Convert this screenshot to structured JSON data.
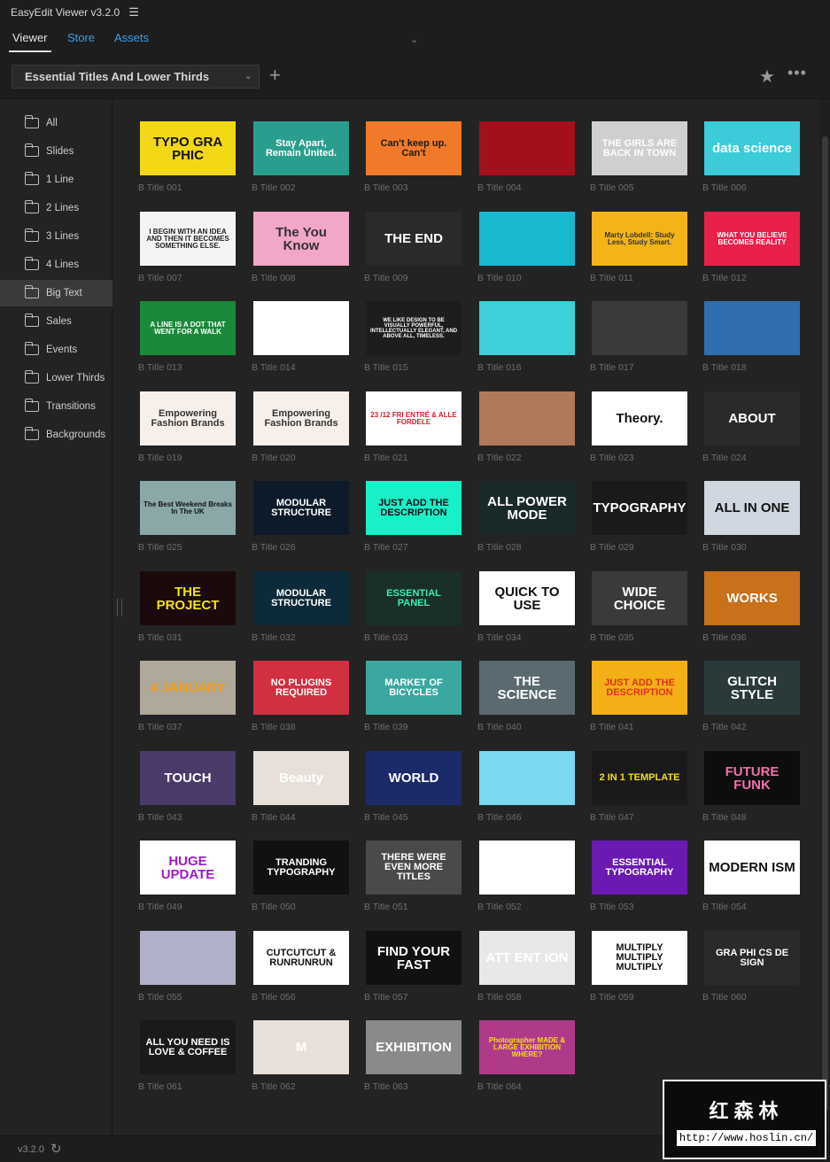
{
  "app": {
    "title": "EasyEdit Viewer v3.2.0",
    "menu_icon": "hamburger-icon"
  },
  "tabs": [
    {
      "label": "Viewer",
      "active": true
    },
    {
      "label": "Store",
      "active": false
    },
    {
      "label": "Assets",
      "active": false
    }
  ],
  "pack_select": {
    "value": "Essential Titles And Lower Thirds"
  },
  "sidebar": {
    "items": [
      {
        "label": "All"
      },
      {
        "label": "Slides"
      },
      {
        "label": "1 Line"
      },
      {
        "label": "2 Lines"
      },
      {
        "label": "3 Lines"
      },
      {
        "label": "4 Lines"
      },
      {
        "label": "Big Text",
        "active": true
      },
      {
        "label": "Sales"
      },
      {
        "label": "Events"
      },
      {
        "label": "Lower Thirds"
      },
      {
        "label": "Transitions"
      },
      {
        "label": "Backgrounds"
      }
    ]
  },
  "items": [
    {
      "caption": "B Title 001",
      "bg": "#f2d816",
      "fg": "#111111",
      "text": "TYPO GRA PHIC"
    },
    {
      "caption": "B Title 002",
      "bg": "#2a9e8e",
      "fg": "#ffffff",
      "text": "Stay Apart, Remain United."
    },
    {
      "caption": "B Title 003",
      "bg": "#f07a2a",
      "fg": "#1a1a1a",
      "text": "Can't keep up. Can't"
    },
    {
      "caption": "B Title 004",
      "bg": "#a3101c",
      "fg": "#ffffff",
      "text": ""
    },
    {
      "caption": "B Title 005",
      "bg": "#cfcfcf",
      "fg": "#ffffff",
      "text": "THE GIRLS ARE BACK IN TOWN"
    },
    {
      "caption": "B Title 006",
      "bg": "#3ccbd8",
      "fg": "#ffffff",
      "text": "data science"
    },
    {
      "caption": "B Title 007",
      "bg": "#f4f4f4",
      "fg": "#222222",
      "text": "I BEGIN WITH AN IDEA AND THEN IT BECOMES SOMETHING ELSE."
    },
    {
      "caption": "B Title 008",
      "bg": "#f2a6c8",
      "fg": "#333333",
      "text": "The You Know"
    },
    {
      "caption": "B Title 009",
      "bg": "#2a2a2a",
      "fg": "#ffffff",
      "text": "THE END"
    },
    {
      "caption": "B Title 010",
      "bg": "#1ab8d0",
      "fg": "#ffffff",
      "text": ""
    },
    {
      "caption": "B Title 011",
      "bg": "#f2b416",
      "fg": "#333333",
      "text": "Marty Lobdell: Study Less, Study Smart."
    },
    {
      "caption": "B Title 012",
      "bg": "#e8204a",
      "fg": "#ffffff",
      "text": "WHAT YOU BELIEVE BECOMES REALITY"
    },
    {
      "caption": "B Title 013",
      "bg": "#1a8a3a",
      "fg": "#ffffff",
      "text": "A LINE IS A DOT THAT WENT FOR A WALK"
    },
    {
      "caption": "B Title 014",
      "bg": "#ffffff",
      "fg": "#3a3a9a",
      "text": ""
    },
    {
      "caption": "B Title 015",
      "bg": "#1d1d1d",
      "fg": "#ffffff",
      "text": "WE LIKE DESIGN TO BE VISUALLY POWERFUL, INTELLECTUALLY ELEGANT, AND ABOVE ALL, TIMELESS."
    },
    {
      "caption": "B Title 016",
      "bg": "#3cd0d8",
      "fg": "#ffffff",
      "text": ""
    },
    {
      "caption": "B Title 017",
      "bg": "#3a3a3a",
      "fg": "#ffffff",
      "text": ""
    },
    {
      "caption": "B Title 018",
      "bg": "#2f6fb0",
      "fg": "#ffffff",
      "text": ""
    },
    {
      "caption": "B Title 019",
      "bg": "#f7f0ea",
      "fg": "#333333",
      "text": "Empowering Fashion Brands"
    },
    {
      "caption": "B Title 020",
      "bg": "#f7f0ea",
      "fg": "#333333",
      "text": "Empowering Fashion Brands"
    },
    {
      "caption": "B Title 021",
      "bg": "#ffffff",
      "fg": "#d81e2a",
      "text": "23 /12 FRI ENTRÉ & ALLE FORDELE"
    },
    {
      "caption": "B Title 022",
      "bg": "#b07a5a",
      "fg": "#ffffff",
      "text": ""
    },
    {
      "caption": "B Title 023",
      "bg": "#ffffff",
      "fg": "#111111",
      "text": "Theory."
    },
    {
      "caption": "B Title 024",
      "bg": "#2a2a2a",
      "fg": "#ffffff",
      "text": "ABOUT"
    },
    {
      "caption": "B Title 025",
      "bg": "#8aa8a8",
      "fg": "#111111",
      "text": "The Best Weekend Breaks In The UK"
    },
    {
      "caption": "B Title 026",
      "bg": "#0d1a2a",
      "fg": "#ffffff",
      "text": "MODULAR STRUCTURE"
    },
    {
      "caption": "B Title 027",
      "bg": "#18f0c8",
      "fg": "#111111",
      "text": "JUST ADD THE DESCRIPTION"
    },
    {
      "caption": "B Title 028",
      "bg": "#1a2a2a",
      "fg": "#ffffff",
      "text": "ALL POWER MODE"
    },
    {
      "caption": "B Title 029",
      "bg": "#1a1a1a",
      "fg": "#ffffff",
      "text": "TYPOGRAPHY"
    },
    {
      "caption": "B Title 030",
      "bg": "#cfd8e0",
      "fg": "#111111",
      "text": "ALL IN ONE"
    },
    {
      "caption": "B Title 031",
      "bg": "#1a0a0a",
      "fg": "#f2e016",
      "text": "THE PROJECT"
    },
    {
      "caption": "B Title 032",
      "bg": "#0d2a3a",
      "fg": "#ffffff",
      "text": "MODULAR STRUCTURE"
    },
    {
      "caption": "B Title 033",
      "bg": "#1a2e2a",
      "fg": "#3af0b0",
      "text": "ESSENTIAL PANEL"
    },
    {
      "caption": "B Title 034",
      "bg": "#ffffff",
      "fg": "#111111",
      "text": "QUICK TO USE"
    },
    {
      "caption": "B Title 035",
      "bg": "#3a3a3a",
      "fg": "#ffffff",
      "text": "WIDE CHOICE"
    },
    {
      "caption": "B Title 036",
      "bg": "#c8701a",
      "fg": "#ffffff",
      "text": "WORKS"
    },
    {
      "caption": "B Title 037",
      "bg": "#b0a898",
      "fg": "#f2a01a",
      "text": "4 JANUARY"
    },
    {
      "caption": "B Title 038",
      "bg": "#d03040",
      "fg": "#ffffff",
      "text": "NO PLUGINS REQUIRED"
    },
    {
      "caption": "B Title 039",
      "bg": "#3aa8a0",
      "fg": "#ffffff",
      "text": "MARKET OF BICYCLES"
    },
    {
      "caption": "B Title 040",
      "bg": "#5a6a70",
      "fg": "#ffffff",
      "text": "THE SCIENCE"
    },
    {
      "caption": "B Title 041",
      "bg": "#f2b016",
      "fg": "#e0301a",
      "text": "JUST ADD THE DESCRIPTION"
    },
    {
      "caption": "B Title 042",
      "bg": "#2a3a3a",
      "fg": "#ffffff",
      "text": "GLITCH STYLE"
    },
    {
      "caption": "B Title 043",
      "bg": "#4a3a6a",
      "fg": "#ffffff",
      "text": "TOUCH"
    },
    {
      "caption": "B Title 044",
      "bg": "#e8e0d8",
      "fg": "#ffffff",
      "text": "Beauty"
    },
    {
      "caption": "B Title 045",
      "bg": "#1a2a6a",
      "fg": "#ffffff",
      "text": "WORLD"
    },
    {
      "caption": "B Title 046",
      "bg": "#7ad8f0",
      "fg": "#ffffff",
      "text": ""
    },
    {
      "caption": "B Title 047",
      "bg": "#1a1a1a",
      "fg": "#f2e016",
      "text": "2 IN 1 TEMPLATE"
    },
    {
      "caption": "B Title 048",
      "bg": "#0d0d0d",
      "fg": "#f070a8",
      "text": "FUTURE FUNK"
    },
    {
      "caption": "B Title 049",
      "bg": "#ffffff",
      "fg": "#a01ac8",
      "text": "HUGE UPDATE"
    },
    {
      "caption": "B Title 050",
      "bg": "#111111",
      "fg": "#ffffff",
      "text": "TRANDING TYPOGRAPHY"
    },
    {
      "caption": "B Title 051",
      "bg": "#4a4a4a",
      "fg": "#ffffff",
      "text": "THERE WERE EVEN MORE TITLES"
    },
    {
      "caption": "B Title 052",
      "bg": "#ffffff",
      "fg": "#cccccc",
      "text": ""
    },
    {
      "caption": "B Title 053",
      "bg": "#6a1ab0",
      "fg": "#ffffff",
      "text": "ESSENTIAL TYPOGRAPHY"
    },
    {
      "caption": "B Title 054",
      "bg": "#ffffff",
      "fg": "#111111",
      "text": "MODERN ISM"
    },
    {
      "caption": "B Title 055",
      "bg": "#b0b0c8",
      "fg": "#ffffff",
      "text": ""
    },
    {
      "caption": "B Title 056",
      "bg": "#ffffff",
      "fg": "#111111",
      "text": "CUTCUTCUT & RUNRUNRUN"
    },
    {
      "caption": "B Title 057",
      "bg": "#111111",
      "fg": "#ffffff",
      "text": "FIND YOUR FAST"
    },
    {
      "caption": "B Title 058",
      "bg": "#e8e8e8",
      "fg": "#ffffff",
      "text": "ATT ENT ION"
    },
    {
      "caption": "B Title 059",
      "bg": "#ffffff",
      "fg": "#111111",
      "text": "MULTIPLY MULTIPLY MULTIPLY"
    },
    {
      "caption": "B Title 060",
      "bg": "#2a2a2a",
      "fg": "#ffffff",
      "text": "GRA PHI CS DE SIGN"
    },
    {
      "caption": "B Title 061",
      "bg": "#1a1a1a",
      "fg": "#ffffff",
      "text": "ALL YOU NEED IS LOVE & COFFEE"
    },
    {
      "caption": "B Title 062",
      "bg": "#e8e0d8",
      "fg": "#ffffff",
      "text": "M"
    },
    {
      "caption": "B Title 063",
      "bg": "#8a8a8a",
      "fg": "#ffffff",
      "text": "EXHIBITION"
    },
    {
      "caption": "B Title 064",
      "bg": "#b03a8a",
      "fg": "#f2e016",
      "text": "Photographer MADE & LARGE EXHIBITION WHERE?"
    }
  ],
  "status": {
    "version": "v3.2.0",
    "refresh_icon": "refresh-icon",
    "settings_icon": "gear-icon"
  },
  "watermark": {
    "title": "红森林",
    "url": "http://www.hoslin.cn/"
  }
}
